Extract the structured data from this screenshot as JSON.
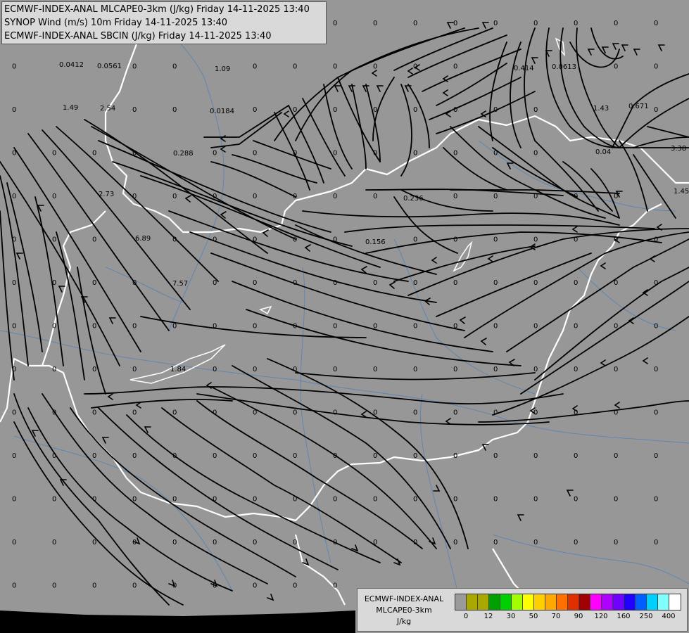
{
  "header": {
    "line1": "ECMWF-INDEX-ANAL MLCAPE0-3km (J/kg) Friday 14-11-2025 13:40",
    "line2": "SYNOP Wind (m/s) 10m Friday 14-11-2025 13:40",
    "line3": "ECMWF-INDEX-ANAL SBCIN (J/kg) Friday 14-11-2025 13:40"
  },
  "colorbar": {
    "title_line1": "ECMWF-INDEX-ANAL",
    "title_line2": "MLCAPE0-3km",
    "title_line3": "J/kg",
    "colors": [
      "#9a9a9a",
      "#a8a800",
      "#a8a800",
      "#00a000",
      "#00d000",
      "#a0ff00",
      "#ffff00",
      "#ffd000",
      "#ffa800",
      "#ff7000",
      "#e03000",
      "#a00000",
      "#ff00ff",
      "#b000ff",
      "#7000ff",
      "#2000ff",
      "#0060ff",
      "#00d0ff",
      "#80ffff",
      "#ffffff"
    ],
    "tick_labels": [
      "0",
      "12",
      "30",
      "50",
      "70",
      "90",
      "120",
      "160",
      "250",
      "400"
    ]
  },
  "cin_values": [
    {
      "label": "0.0412"
    },
    {
      "label": "0.0561"
    },
    {
      "label": "1.09"
    },
    {
      "label": "0.414"
    },
    {
      "label": "0.0613"
    },
    {
      "label": "1.49"
    },
    {
      "label": "2.54"
    },
    {
      "label": "0.0184"
    },
    {
      "label": "1.43"
    },
    {
      "label": "0.671"
    },
    {
      "label": "0.288"
    },
    {
      "label": "0.04"
    },
    {
      "label": "3.38"
    },
    {
      "label": "2.73"
    },
    {
      "label": "0.236"
    },
    {
      "label": "1.45"
    },
    {
      "label": "6.89"
    },
    {
      "label": "0.156"
    },
    {
      "label": "7.57"
    },
    {
      "label": "1.84"
    }
  ]
}
